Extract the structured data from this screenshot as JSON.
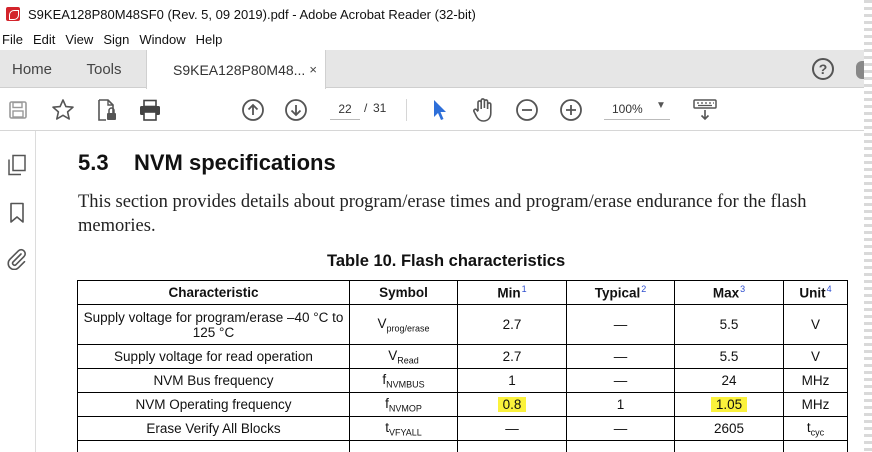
{
  "window": {
    "title": "S9KEA128P80M48SF0 (Rev. 5, 09 2019).pdf - Adobe Acrobat Reader (32-bit)"
  },
  "menu": [
    "File",
    "Edit",
    "View",
    "Sign",
    "Window",
    "Help"
  ],
  "tabs": {
    "home": "Home",
    "tools": "Tools",
    "document": "S9KEA128P80M48...",
    "close": "×"
  },
  "toolbar": {
    "current_page": "22",
    "page_separator": "/",
    "total_pages": "31",
    "zoom": "100%",
    "icons": [
      "save-icon",
      "bookmark-star-icon",
      "share-file-icon",
      "print-icon",
      "page-up-icon",
      "page-down-icon",
      "select-cursor-icon",
      "hand-tool-icon",
      "zoom-out-icon",
      "zoom-in-icon",
      "keyboard-scroll-icon"
    ]
  },
  "sidebar": {
    "icons": [
      "pages-icon",
      "bookmark-icon",
      "attachment-icon"
    ]
  },
  "document": {
    "section_number": "5.3",
    "section_title": "NVM specifications",
    "paragraph": "This section provides details about program/erase times and program/erase endurance for the flash memories.",
    "table_caption": "Table 10.   Flash characteristics",
    "table": {
      "headers": [
        {
          "label": "Characteristic",
          "fn": ""
        },
        {
          "label": "Symbol",
          "fn": ""
        },
        {
          "label": "Min",
          "fn": "1"
        },
        {
          "label": "Typical",
          "fn": "2"
        },
        {
          "label": "Max",
          "fn": "3"
        },
        {
          "label": "Unit",
          "fn": "4"
        }
      ],
      "rows": [
        {
          "characteristic": "Supply voltage for program/erase –40 °C to 125 °C",
          "symbol_main": "V",
          "symbol_sub": "prog/erase",
          "min": "2.7",
          "typical": "—",
          "max": "5.5",
          "unit": "V",
          "unit_sub": ""
        },
        {
          "characteristic": "Supply voltage for read operation",
          "symbol_main": "V",
          "symbol_sub": "Read",
          "min": "2.7",
          "typical": "—",
          "max": "5.5",
          "unit": "V",
          "unit_sub": ""
        },
        {
          "characteristic": "NVM Bus frequency",
          "symbol_main": "f",
          "symbol_sub": "NVMBUS",
          "min": "1",
          "typical": "—",
          "max": "24",
          "unit": "MHz",
          "unit_sub": ""
        },
        {
          "characteristic": "NVM Operating frequency",
          "symbol_main": "f",
          "symbol_sub": "NVMOP",
          "min": "0.8",
          "typical": "1",
          "max": "1.05",
          "unit": "MHz",
          "unit_sub": ""
        },
        {
          "characteristic": "Erase Verify All Blocks",
          "symbol_main": "t",
          "symbol_sub": "VFYALL",
          "min": "—",
          "typical": "—",
          "max": "2605",
          "unit": "t",
          "unit_sub": "cyc"
        }
      ],
      "highlight_color": "#fbf23b"
    }
  }
}
